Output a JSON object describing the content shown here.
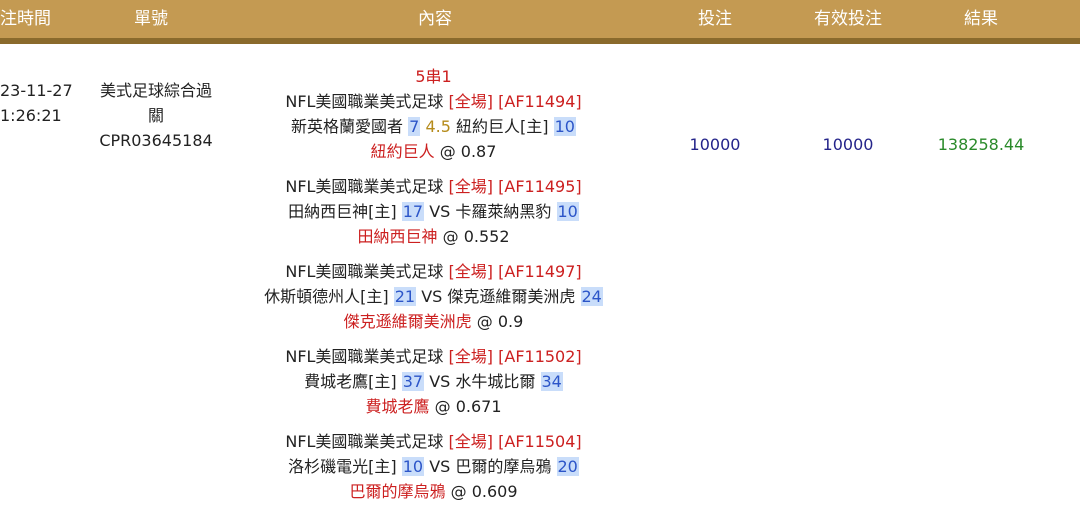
{
  "header": {
    "time": "注時間",
    "order_id": "單號",
    "content": "內容",
    "bet": "投注",
    "valid_bet": "有效投注",
    "result": "結果"
  },
  "row": {
    "date": "23-11-27",
    "time": "1:26:21",
    "bet_type": "美式足球綜合過關",
    "order_id": "CPR03645184",
    "combo": "5串1",
    "bet_amount": "10000",
    "valid_amount": "10000",
    "result": "138258.44",
    "legs": [
      {
        "league": "NFL美國職業美式足球",
        "period": "[全場]",
        "code": "[AF11494]",
        "team1": "新英格蘭愛國者",
        "score1": "7",
        "handicap": "4.5",
        "team2": "紐約巨人[主]",
        "score2": "10",
        "pick": "紐約巨人",
        "odds": "@ 0.87"
      },
      {
        "league": "NFL美國職業美式足球",
        "period": "[全場]",
        "code": "[AF11495]",
        "team1": "田納西巨神[主]",
        "score1": "17",
        "vs": "VS",
        "team2": "卡羅萊納黑豹",
        "score2": "10",
        "pick": "田納西巨神",
        "odds": "@ 0.552"
      },
      {
        "league": "NFL美國職業美式足球",
        "period": "[全場]",
        "code": "[AF11497]",
        "team1": "休斯頓德州人[主]",
        "score1": "21",
        "vs": "VS",
        "team2": "傑克遜維爾美洲虎",
        "score2": "24",
        "pick": "傑克遜維爾美洲虎",
        "odds": "@ 0.9"
      },
      {
        "league": "NFL美國職業美式足球",
        "period": "[全場]",
        "code": "[AF11502]",
        "team1": "費城老鷹[主]",
        "score1": "37",
        "vs": "VS",
        "team2": "水牛城比爾",
        "score2": "34",
        "pick": "費城老鷹",
        "odds": "@ 0.671"
      },
      {
        "league": "NFL美國職業美式足球",
        "period": "[全場]",
        "code": "[AF11504]",
        "team1": "洛杉磯電光[主]",
        "score1": "10",
        "vs": "VS",
        "team2": "巴爾的摩烏鴉",
        "score2": "20",
        "pick": "巴爾的摩烏鴉",
        "odds": "@ 0.609"
      }
    ]
  },
  "colors": {
    "header_bg": "#c49a52",
    "header_border": "#8a6a2c",
    "accent_red": "#cc2020",
    "score_highlight": "#c9ddfa",
    "score_text": "#2c55c8",
    "amount_blue": "#24248a",
    "result_green": "#2a8a2a"
  }
}
